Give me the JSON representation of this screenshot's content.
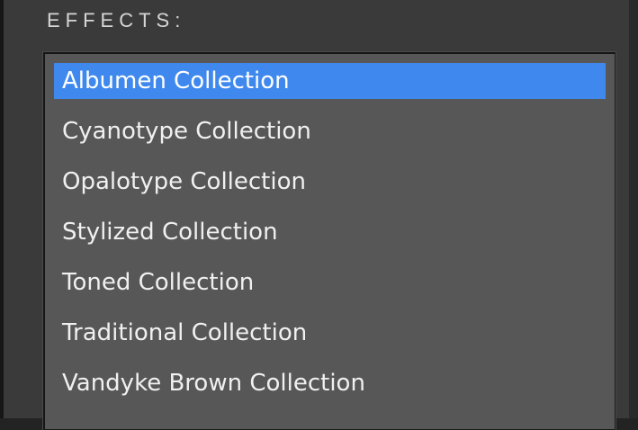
{
  "panel": {
    "title": "EFFECTS:"
  },
  "effects_list": {
    "selected_index": 0,
    "items": [
      {
        "label": "Albumen Collection"
      },
      {
        "label": "Cyanotype Collection"
      },
      {
        "label": "Opalotype Collection"
      },
      {
        "label": "Stylized Collection"
      },
      {
        "label": "Toned Collection"
      },
      {
        "label": "Traditional Collection"
      },
      {
        "label": "Vandyke Brown Collection"
      }
    ]
  },
  "colors": {
    "panel_background": "#3a3a3a",
    "list_background": "#575757",
    "selection_highlight": "#3f89ee",
    "text": "#f0f0f0"
  }
}
